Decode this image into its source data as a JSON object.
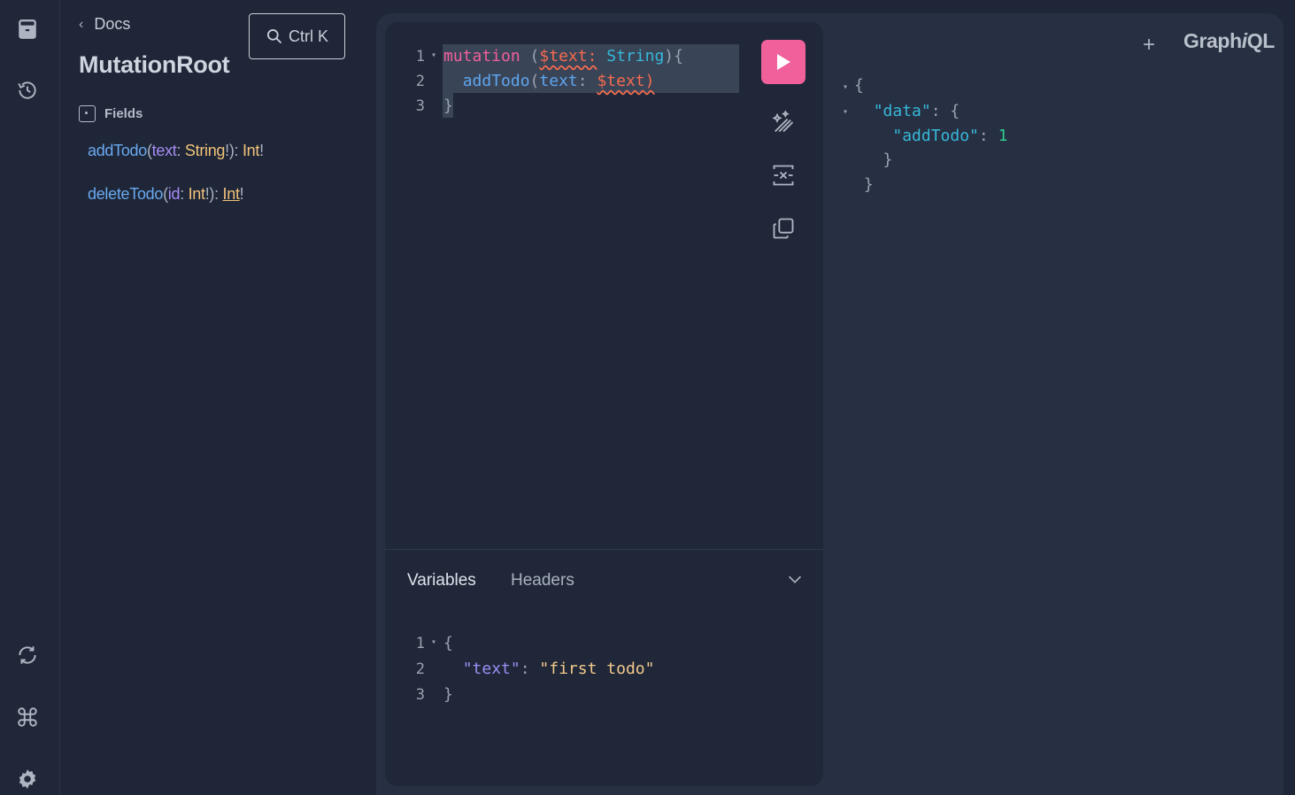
{
  "sidebar": {
    "icons": [
      "docs-icon",
      "history-icon",
      "refetch-schema-icon",
      "shortcuts-icon",
      "settings-icon"
    ]
  },
  "docs": {
    "back_label": "Docs",
    "search_shortcut": "Ctrl K",
    "title": "MutationRoot",
    "fields_header": "Fields",
    "fields": [
      {
        "name": "addTodo",
        "arg": "text",
        "arg_type": "String",
        "return_type": "Int"
      },
      {
        "name": "deleteTodo",
        "arg": "id",
        "arg_type": "Int",
        "return_type": "Int"
      }
    ]
  },
  "editor": {
    "line_numbers": [
      "1",
      "2",
      "3"
    ],
    "query": {
      "kw": "mutation",
      "var": "$text:",
      "type": "String",
      "field": "addTodo",
      "arg": "text",
      "argval": "$text"
    },
    "tabs": {
      "variables": "Variables",
      "headers": "Headers"
    },
    "variables": {
      "line_numbers": [
        "1",
        "2",
        "3"
      ],
      "key": "\"text\"",
      "value": "\"first todo\""
    }
  },
  "result": {
    "data_key": "\"data\"",
    "field_key": "\"addTodo\"",
    "value": "1"
  },
  "header": {
    "brand_prefix": "Graph",
    "brand_italic": "i",
    "brand_suffix": "QL",
    "add_tab": "+"
  },
  "colors": {
    "accent": "#f0609b",
    "background": "#1e2637",
    "panel": "#273042"
  }
}
